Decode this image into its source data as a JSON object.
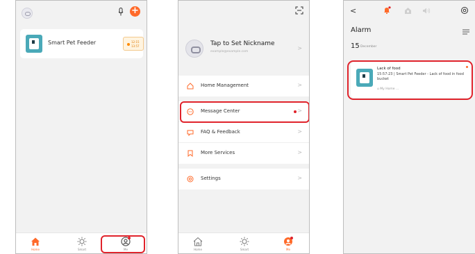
{
  "colors": {
    "accent": "#ff6a2a",
    "highlight": "#e0232b",
    "device_teal": "#4aa9b8"
  },
  "home_screen": {
    "device": {
      "name": "Smart Pet Feeder",
      "badge_line1": "12:15",
      "badge_line2": "13:57"
    },
    "tabs": [
      {
        "label": "Home",
        "icon": "home-icon"
      },
      {
        "label": "Smart",
        "icon": "sun-icon"
      },
      {
        "label": "Me",
        "icon": "user-icon"
      }
    ]
  },
  "me_screen": {
    "profile": {
      "nickname": "Tap to Set Nickname",
      "email": "example@example.com"
    },
    "menu": {
      "home_management": "Home Management",
      "message_center": "Message Center",
      "faq_feedback": "FAQ & Feedback",
      "more_services": "More Services",
      "settings": "Settings"
    },
    "tabs": [
      {
        "label": "Home",
        "icon": "home-icon"
      },
      {
        "label": "Smart",
        "icon": "sun-icon"
      },
      {
        "label": "Me",
        "icon": "user-icon"
      }
    ]
  },
  "alarm_screen": {
    "title": "Alarm",
    "date_day": "15",
    "date_month": "December",
    "alarm": {
      "title": "Lack of food",
      "message": "15:57:23 | Smart Pet Feeder - Lack of food in food bucket",
      "location": "My Home ..."
    }
  }
}
